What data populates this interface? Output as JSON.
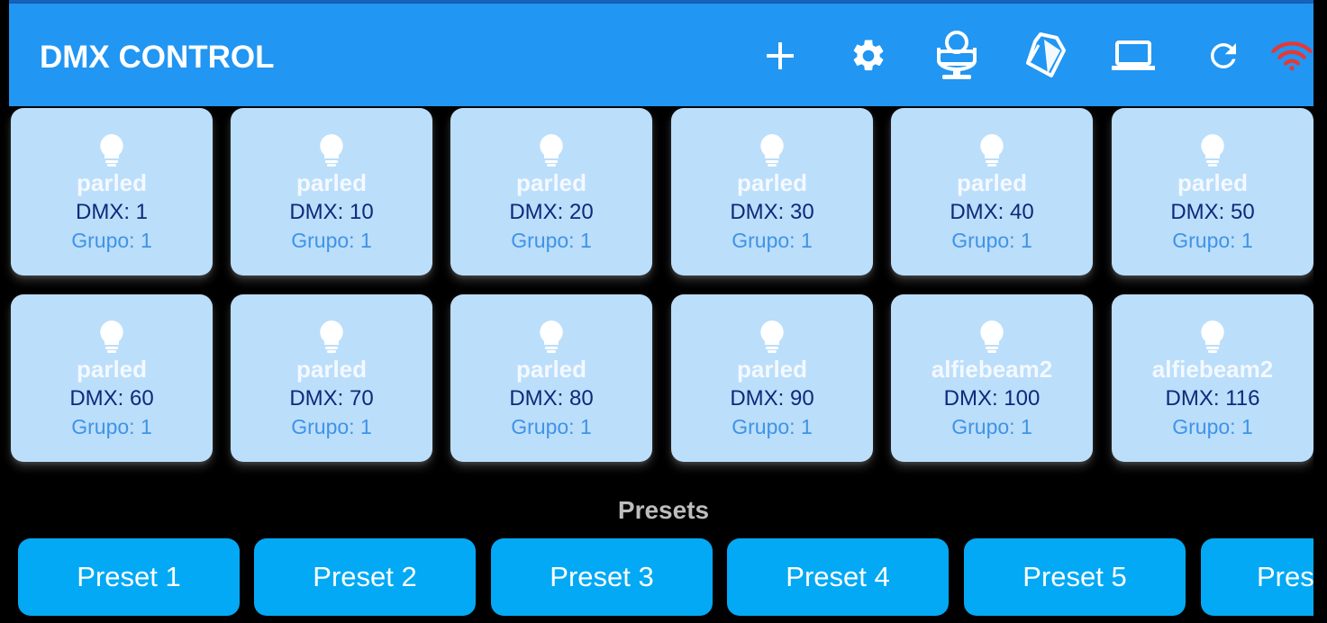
{
  "app": {
    "title": "DMX CONTROL",
    "accent": "#2196f3",
    "actions": [
      {
        "name": "add-icon",
        "label": "+"
      },
      {
        "name": "gear-icon"
      },
      {
        "name": "moving-head-icon"
      },
      {
        "name": "spotlight-icon"
      },
      {
        "name": "laptop-icon"
      },
      {
        "name": "refresh-icon"
      },
      {
        "name": "wifi-icon",
        "color": "#e53935"
      }
    ]
  },
  "fixtures": [
    {
      "name": "parled",
      "dmx": "DMX: 1",
      "group": "Grupo: 1"
    },
    {
      "name": "parled",
      "dmx": "DMX: 10",
      "group": "Grupo: 1"
    },
    {
      "name": "parled",
      "dmx": "DMX: 20",
      "group": "Grupo: 1"
    },
    {
      "name": "parled",
      "dmx": "DMX: 30",
      "group": "Grupo: 1"
    },
    {
      "name": "parled",
      "dmx": "DMX: 40",
      "group": "Grupo: 1"
    },
    {
      "name": "parled",
      "dmx": "DMX: 50",
      "group": "Grupo: 1"
    },
    {
      "name": "parled",
      "dmx": "DMX: 60",
      "group": "Grupo: 1"
    },
    {
      "name": "parled",
      "dmx": "DMX: 70",
      "group": "Grupo: 1"
    },
    {
      "name": "parled",
      "dmx": "DMX: 80",
      "group": "Grupo: 1"
    },
    {
      "name": "parled",
      "dmx": "DMX: 90",
      "group": "Grupo: 1"
    },
    {
      "name": "alfiebeam2",
      "dmx": "DMX: 100",
      "group": "Grupo: 1"
    },
    {
      "name": "alfiebeam2",
      "dmx": "DMX: 116",
      "group": "Grupo: 1"
    }
  ],
  "presets": {
    "title": "Presets",
    "items": [
      "Preset 1",
      "Preset 2",
      "Preset 3",
      "Preset 4",
      "Preset 5",
      "Pres"
    ]
  },
  "colors": {
    "card_bg": "#bbdefb",
    "preset_bg": "#03a9f4"
  }
}
